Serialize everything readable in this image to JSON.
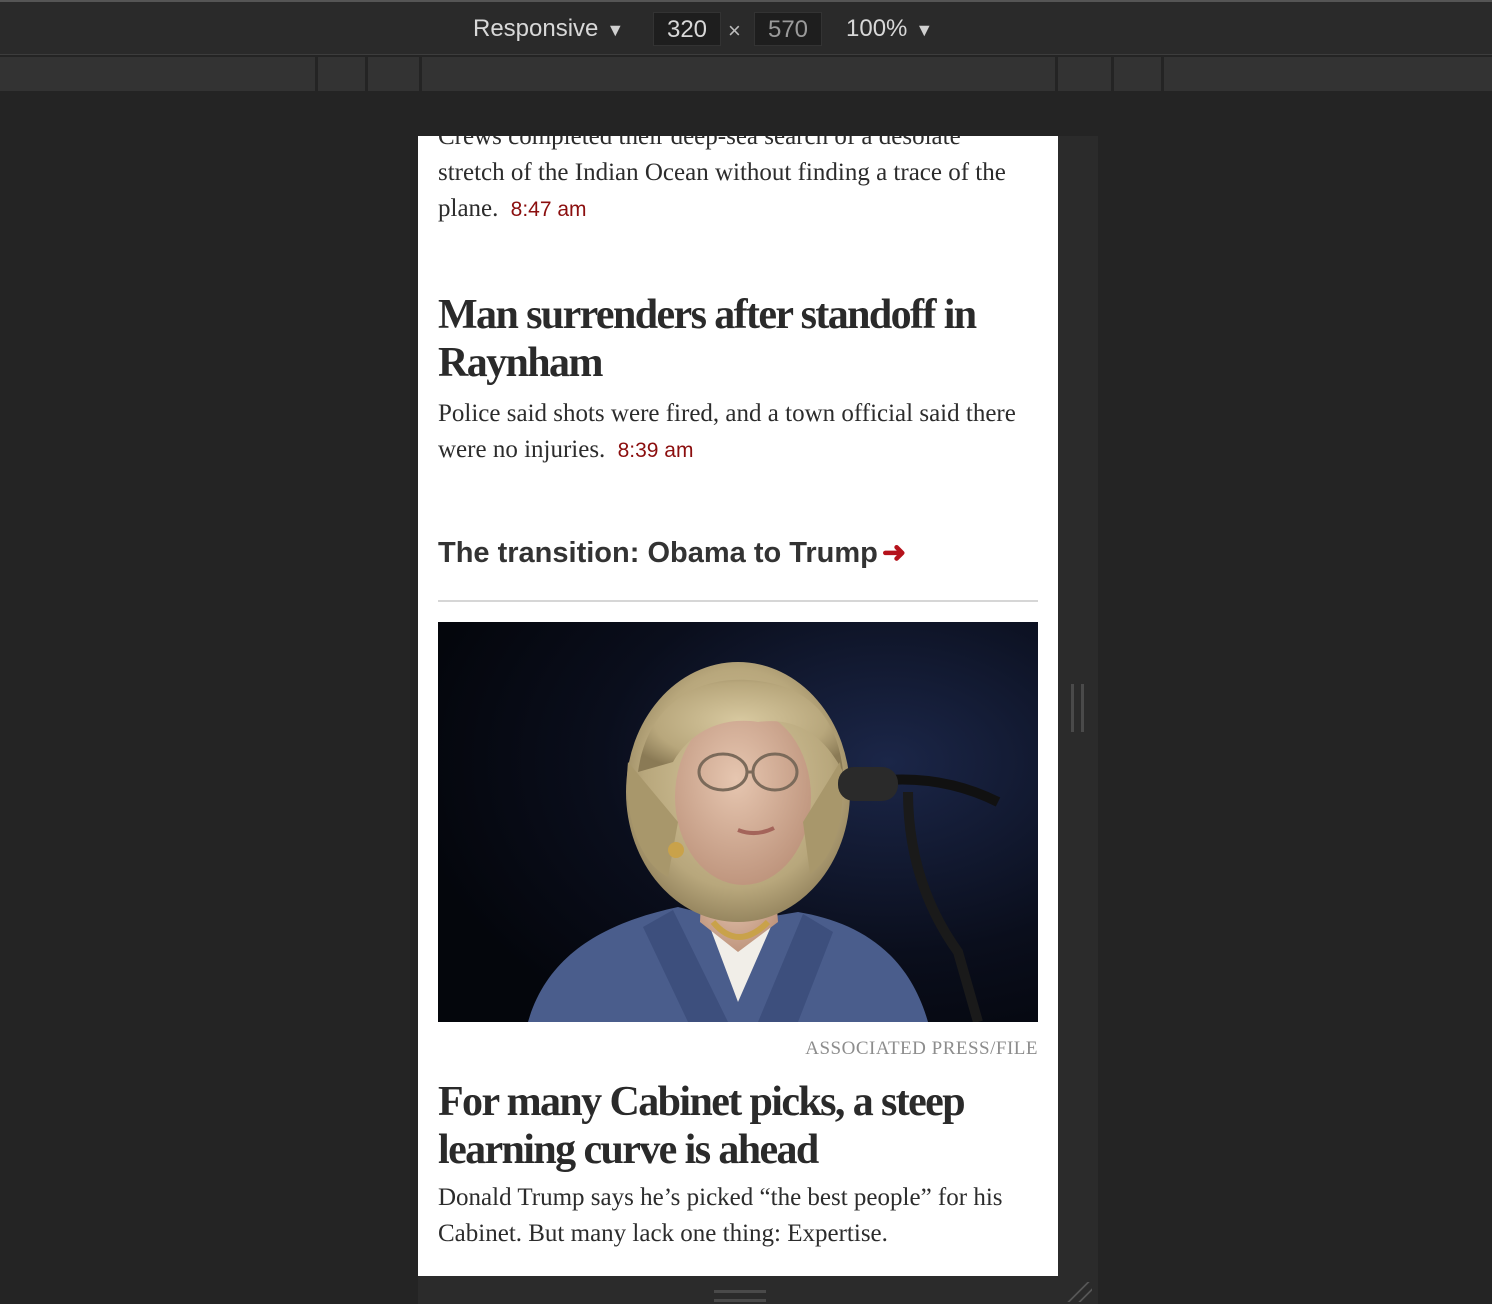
{
  "toolbar": {
    "device_mode": "Responsive",
    "width": "320",
    "times": "×",
    "height": "570",
    "zoom": "100%",
    "caret_icon": "▼"
  },
  "stories": [
    {
      "headline_fragment": "Crews completed their deep-sea search of a desolate",
      "dek_rest": "stretch of the Indian Ocean without finding a trace of the plane.",
      "time": "8:47 am"
    },
    {
      "headline": "Man surrenders after standoff in Raynham",
      "dek": "Police said shots were fired, and a town official said there were no injuries.",
      "time": "8:39 am"
    }
  ],
  "section_link": {
    "label": "The transition: Obama to Trump",
    "arrow": "➜"
  },
  "featured": {
    "photo_credit": "ASSOCIATED PRESS/FILE",
    "headline": "For many Cabinet picks, a steep learning curve is ahead",
    "dek": "Donald Trump says he’s picked “the best people” for his Cabinet. But many lack one thing: Expertise."
  },
  "colors": {
    "timestamp": "#8b0e0e",
    "arrow": "#b5121b",
    "devtools_bg": "#242424"
  }
}
